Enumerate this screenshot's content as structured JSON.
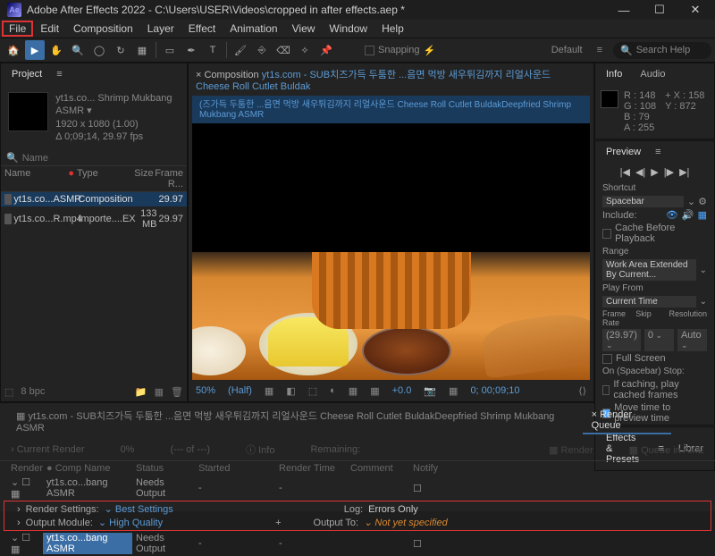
{
  "titlebar": {
    "app_label": "Ae",
    "title": "Adobe After Effects 2022 - C:\\Users\\USER\\Videos\\cropped in after effects.aep *"
  },
  "menubar": [
    "File",
    "Edit",
    "Composition",
    "Layer",
    "Effect",
    "Animation",
    "View",
    "Window",
    "Help"
  ],
  "toolbar": {
    "snapping": "Snapping",
    "workspace": "Default",
    "search_placeholder": "Search Help"
  },
  "project": {
    "tab": "Project",
    "footage_name": "yt1s.co... Shrimp Mukbang ASMR ▾",
    "footage_dims": "1920 x 1080 (1.00)",
    "footage_dur": "Δ 0;09;14, 29.97 fps",
    "search_icon": "🔍",
    "name_placeholder": "Name",
    "cols": {
      "name": "Name",
      "type": "Type",
      "size": "Size",
      "frame": "Frame R..."
    },
    "rows": [
      {
        "name": "yt1s.co...ASMR",
        "type": "Composition",
        "size": "",
        "frame": "29.97"
      },
      {
        "name": "yt1s.co...R.mp4",
        "type": "Importe....EX",
        "size": "133 MB",
        "frame": "29.97"
      }
    ],
    "footer": {
      "bpc": "8 bpc"
    }
  },
  "composition": {
    "tab": "Composition",
    "path": "yt1s.com - SUB치즈가득 두툼한 ...음면 먹방 새우튀김까지 리얼사운드 Cheese Roll Cutlet Buldak",
    "subpath": "(즈가득 두툼한 ...음면 먹방 새우튀김까지 리얼사운드 Cheese Roll Cutlet BuldakDeepfried Shrimp Mukbang ASMR",
    "controls": {
      "zoom": "50%",
      "res": "(Half)",
      "exposure": "+0.0",
      "time": "0; 00;09;10"
    }
  },
  "right": {
    "info_tab": "Info",
    "audio_tab": "Audio",
    "info": {
      "r": "R : 148",
      "g": "G : 108",
      "b": "B : 79",
      "a": "A : 255",
      "x": "X : 158",
      "y": "Y : 872"
    },
    "preview_tab": "Preview",
    "shortcut_label": "Shortcut",
    "shortcut_val": "Spacebar",
    "include_label": "Include:",
    "cache_before": "Cache Before Playback",
    "range_label": "Range",
    "range_val": "Work Area Extended By Current...",
    "playfrom_label": "Play From",
    "playfrom_val": "Current Time",
    "framerate": "Frame Rate",
    "skip": "Skip",
    "resolution": "Resolution",
    "fr_val": "(29.97)",
    "skip_val": "0",
    "res_val": "Auto",
    "fullscreen": "Full Screen",
    "onstop_label": "On (Spacebar) Stop:",
    "onstop1": "If caching, play cached frames",
    "onstop2": "Move time to preview time",
    "effects_tab": "Effects & Presets",
    "libraries_tab": "Librar"
  },
  "timeline": {
    "tab1": "yt1s.com - SUB치즈가득 두툼한 ...음면 먹방 새우튀김까지 리얼사운드 Cheese Roll Cutlet BuldakDeepfried Shrimp Mukbang ASMR",
    "tab2": "Render Queue",
    "current_render": "Current Render",
    "pct": "0%",
    "of": "(--- of ---)",
    "info_btn": "Info",
    "remaining": "Remaining:",
    "render_btn": "Render",
    "ame_btn": "Queue in AME",
    "cols": {
      "render": "Render",
      "comp": "Comp Name",
      "status": "Status",
      "started": "Started",
      "rtime": "Render Time",
      "comment": "Comment",
      "notify": "Notify"
    },
    "rows": [
      {
        "comp": "yt1s.co...bang ASMR",
        "status": "Needs Output"
      }
    ],
    "settings": {
      "rs_label": "Render Settings:",
      "rs_val": "Best Settings",
      "om_label": "Output Module:",
      "om_val": "High Quality",
      "log_label": "Log:",
      "log_val": "Errors Only",
      "out_label": "Output To:",
      "out_val": "Not yet specified"
    }
  }
}
